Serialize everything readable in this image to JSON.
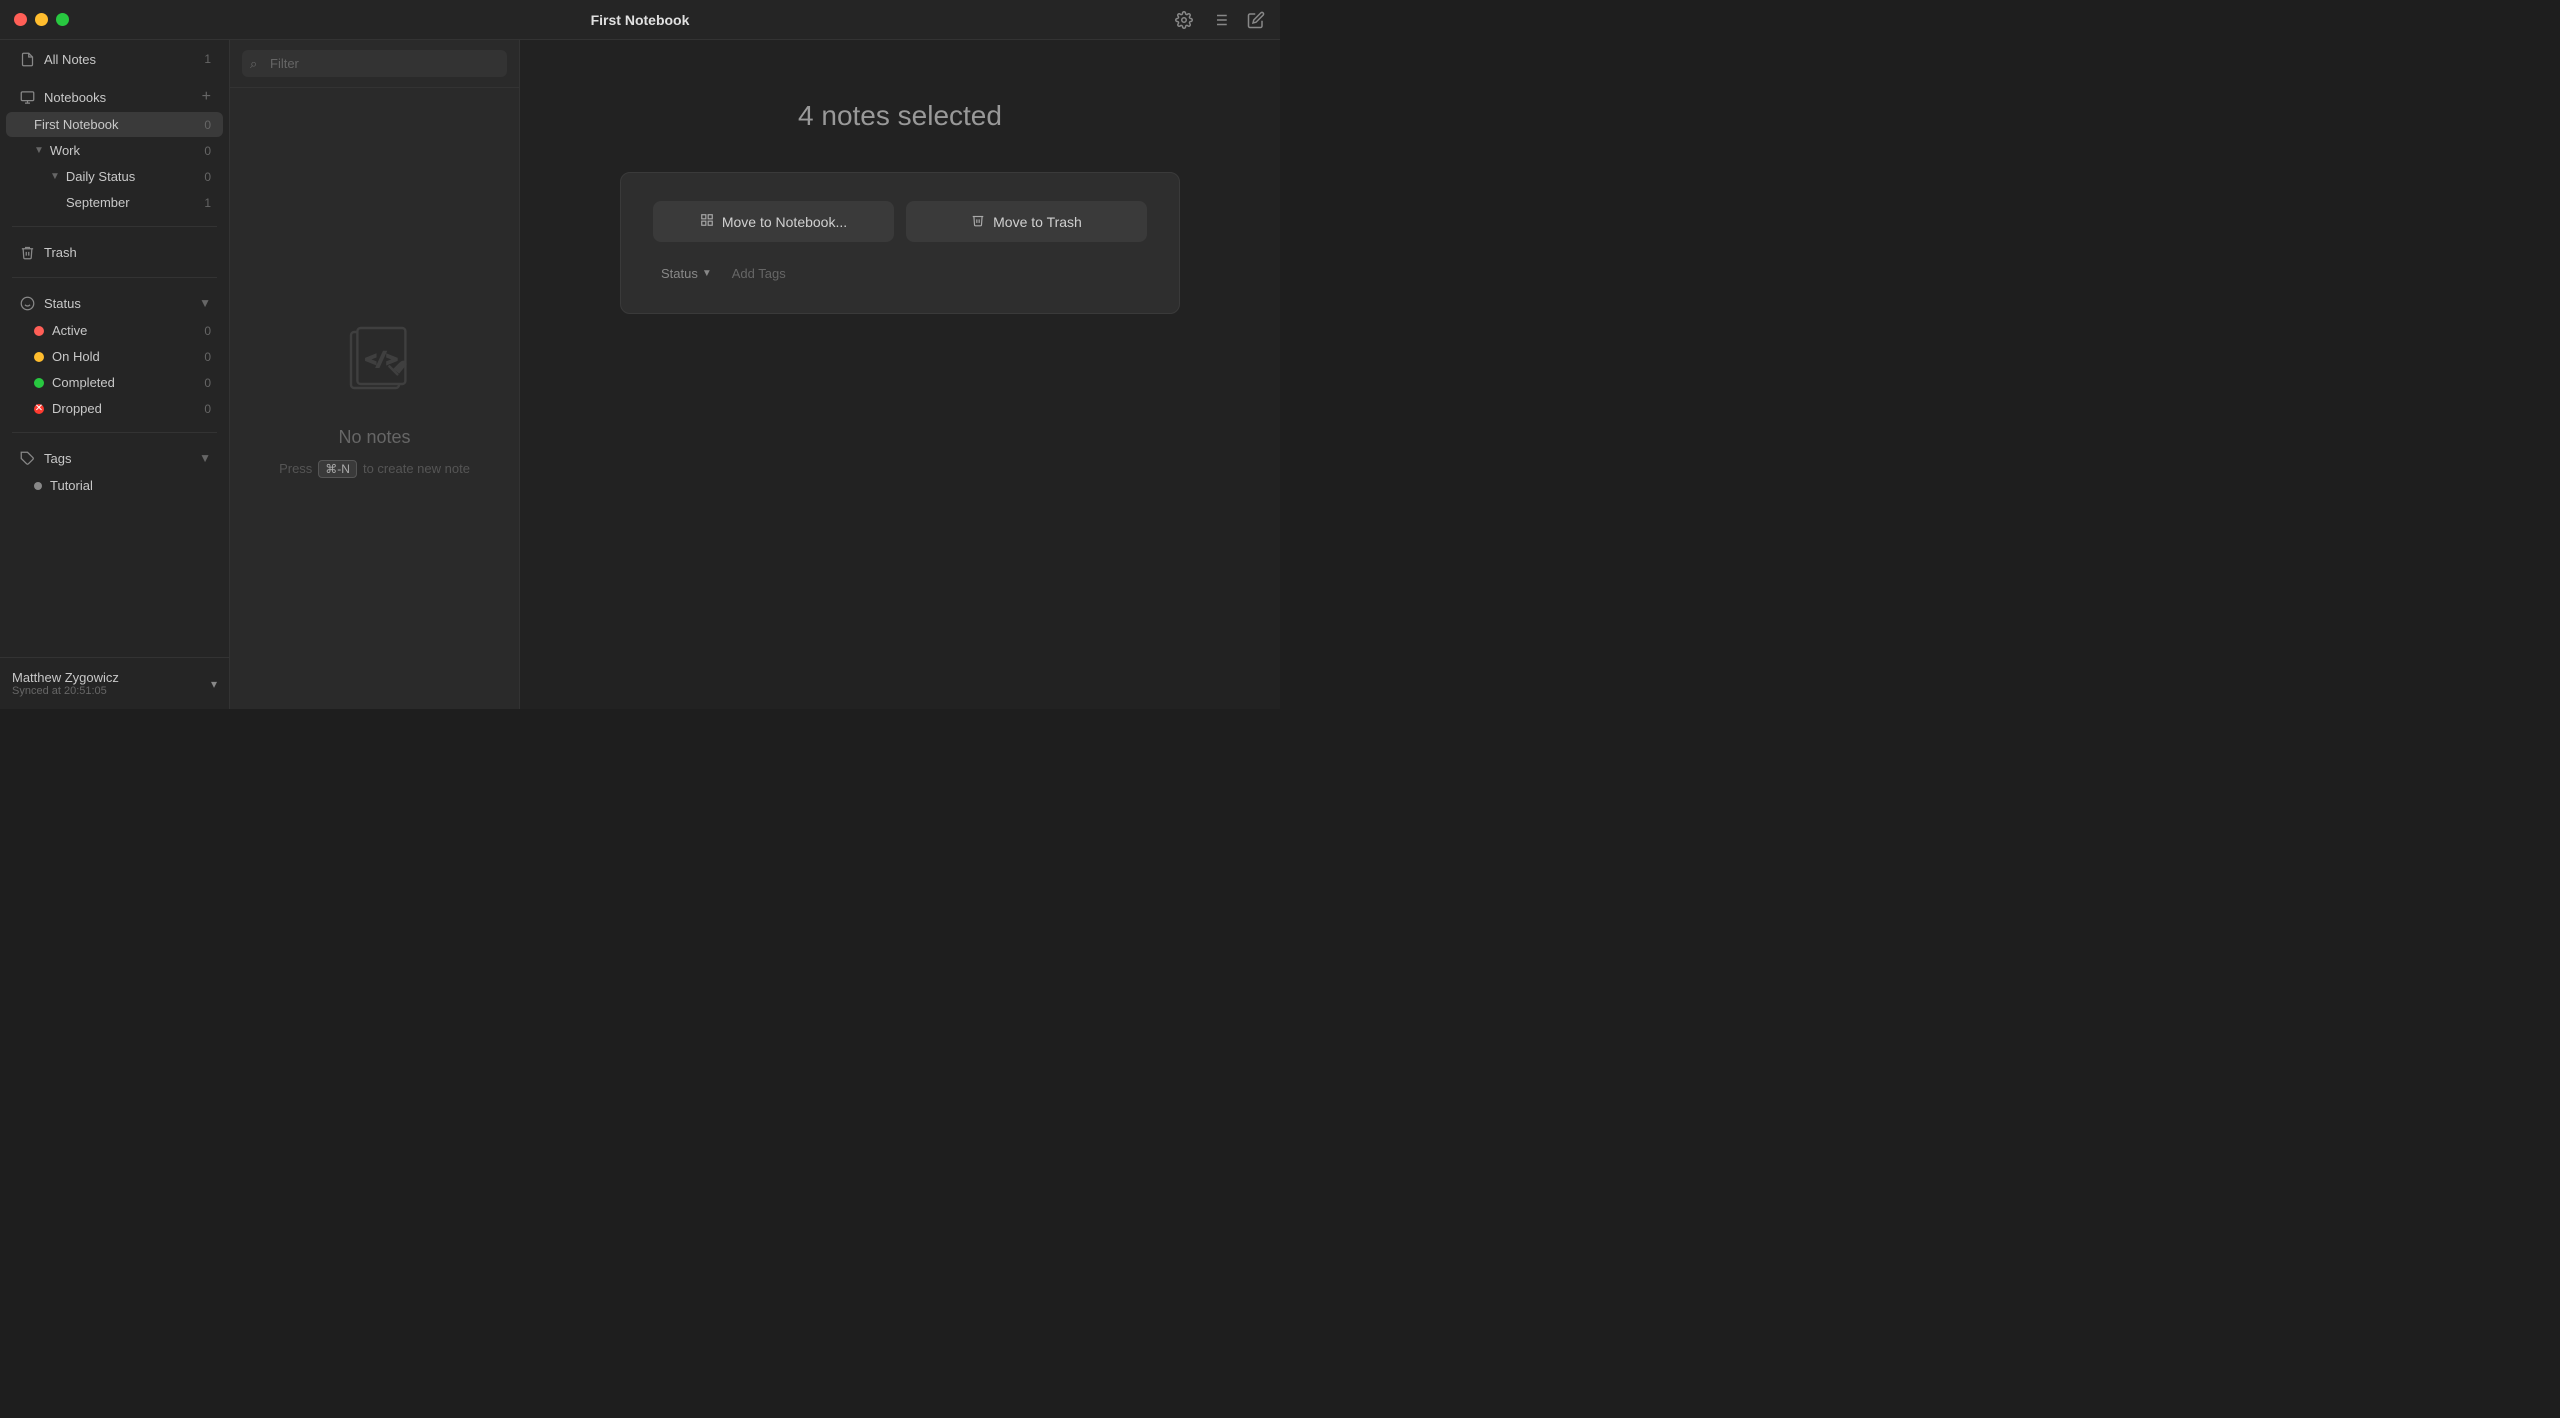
{
  "titlebar": {
    "title": "First Notebook",
    "traffic": {
      "close": "close",
      "minimize": "minimize",
      "maximize": "maximize"
    }
  },
  "sidebar": {
    "all_notes": {
      "label": "All Notes",
      "count": "1"
    },
    "notebooks": {
      "label": "Notebooks",
      "count": ""
    },
    "first_notebook": {
      "label": "First Notebook",
      "count": "0"
    },
    "work": {
      "label": "Work",
      "count": "0"
    },
    "daily_status": {
      "label": "Daily Status",
      "count": "0"
    },
    "september": {
      "label": "September",
      "count": "1"
    },
    "trash": {
      "label": "Trash",
      "count": ""
    },
    "status": {
      "label": "Status"
    },
    "active": {
      "label": "Active",
      "count": "0"
    },
    "onhold": {
      "label": "On Hold",
      "count": "0"
    },
    "completed": {
      "label": "Completed",
      "count": "0"
    },
    "dropped": {
      "label": "Dropped",
      "count": "0"
    },
    "tags": {
      "label": "Tags"
    },
    "tutorial": {
      "label": "Tutorial"
    },
    "footer": {
      "name": "Matthew Zygowicz",
      "sync": "Synced at 20:51:05"
    }
  },
  "filter": {
    "placeholder": "Filter"
  },
  "empty_state": {
    "title": "No notes",
    "hint_prefix": "Press",
    "kbd": "⌘-N",
    "hint_suffix": "to create new note"
  },
  "content": {
    "selected_text": "4 notes selected",
    "move_to_notebook": "Move to Notebook...",
    "move_to_trash": "Move to Trash",
    "status_label": "Status",
    "add_tags": "Add Tags"
  }
}
